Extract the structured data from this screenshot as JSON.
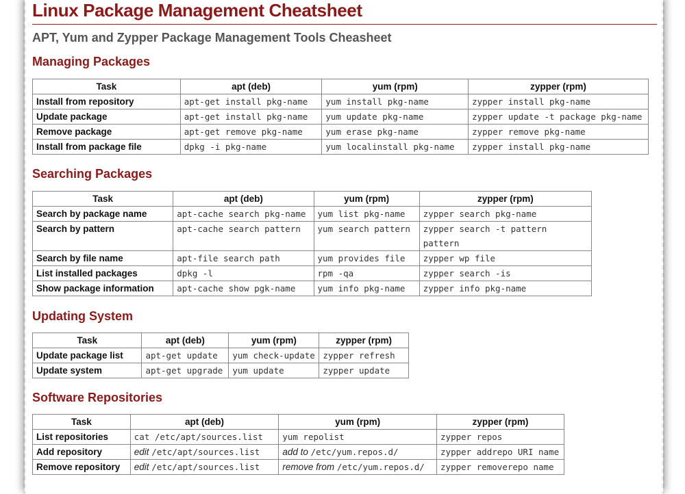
{
  "title": "Linux Package Management Cheatsheet",
  "subtitle": "APT, Yum and Zypper Package Management Tools Cheasheet",
  "columns": [
    "Task",
    "apt (deb)",
    "yum (rpm)",
    "zypper (rpm)"
  ],
  "sections": {
    "managing": {
      "heading": "Managing Packages",
      "rows": [
        [
          "Install from repository",
          "apt-get install pkg-name",
          "yum install pkg-name",
          "zypper install pkg-name"
        ],
        [
          "Update package",
          "apt-get install pkg-name",
          "yum update pkg-name",
          "zypper update -t package pkg-name"
        ],
        [
          "Remove package",
          "apt-get remove pkg-name",
          "yum erase pkg-name",
          "zypper remove pkg-name"
        ],
        [
          "Install from package file",
          "dpkg -i pkg-name",
          "yum localinstall pkg-name",
          "zypper install pkg-name"
        ]
      ]
    },
    "searching": {
      "heading": "Searching Packages",
      "rows": [
        [
          "Search by package name",
          "apt-cache search pkg-name",
          "yum list pkg-name",
          "zypper search pkg-name"
        ],
        [
          "Search by pattern",
          "apt-cache search pattern",
          "yum search pattern",
          "zypper search -t pattern pattern"
        ],
        [
          "Search by file name",
          "apt-file search path",
          "yum provides file",
          "zypper wp file"
        ],
        [
          "List installed packages",
          "dpkg -l",
          "rpm -qa",
          "zypper search -is"
        ],
        [
          "Show package information",
          "apt-cache show pgk-name",
          "yum info pkg-name",
          "zypper info pkg-name"
        ]
      ]
    },
    "updating": {
      "heading": "Updating System",
      "rows": [
        [
          "Update package list",
          "apt-get update",
          "yum check-update",
          "zypper refresh"
        ],
        [
          "Update system",
          "apt-get upgrade",
          "yum update",
          "zypper update"
        ]
      ]
    },
    "repos": {
      "heading": "Software Repositories",
      "rows": [
        {
          "task": "List repositories",
          "apt_pre": "",
          "apt_code": "cat /etc/apt/sources.list",
          "yum_pre": "",
          "yum_code": "yum repolist",
          "zypper": "zypper repos"
        },
        {
          "task": "Add repository",
          "apt_pre": "edit ",
          "apt_code": "/etc/apt/sources.list",
          "yum_pre": "add to ",
          "yum_code": "/etc/yum.repos.d/",
          "zypper": "zypper addrepo URI name"
        },
        {
          "task": "Remove repository",
          "apt_pre": "edit ",
          "apt_code": "/etc/apt/sources.list",
          "yum_pre": "remove from ",
          "yum_code": "/etc/yum.repos.d/",
          "zypper": "zypper removerepo name"
        }
      ]
    }
  }
}
